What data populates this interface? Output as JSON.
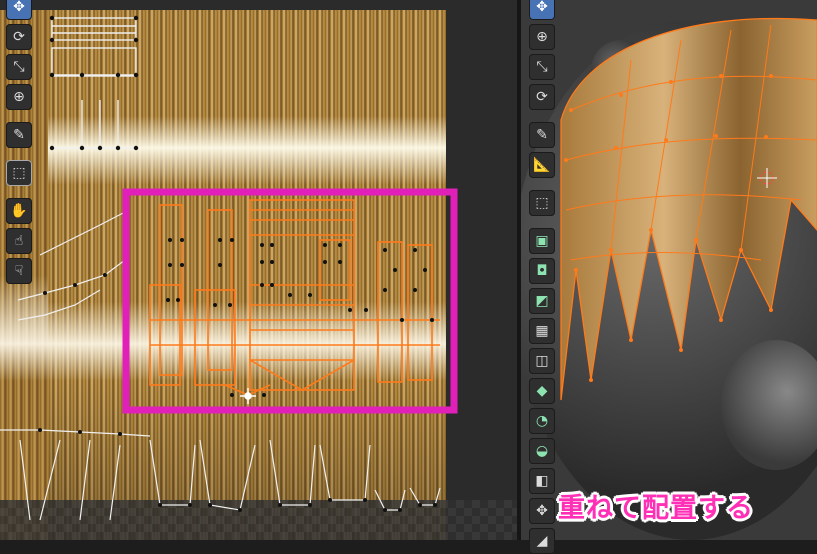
{
  "uv_editor": {
    "tools": [
      {
        "icon": "move-icon",
        "glyph": "✥",
        "active": true
      },
      {
        "icon": "rotate-icon",
        "glyph": "⟳"
      },
      {
        "icon": "scale-icon",
        "glyph": "⤡"
      },
      {
        "icon": "transform-icon",
        "glyph": "⊕"
      },
      {
        "icon": "annotate-icon",
        "glyph": "✎"
      },
      {
        "icon": "cube-icon",
        "glyph": "⬚",
        "active_outline": true
      },
      {
        "icon": "grab-icon",
        "glyph": "✋"
      },
      {
        "icon": "relax-icon",
        "glyph": "☝"
      },
      {
        "icon": "pinch-icon",
        "glyph": "☟"
      }
    ]
  },
  "viewport_3d": {
    "tools": [
      {
        "icon": "move-icon",
        "glyph": "✥",
        "active": true
      },
      {
        "icon": "transform-icon",
        "glyph": "⊕"
      },
      {
        "icon": "scale-icon",
        "glyph": "⤡"
      },
      {
        "icon": "rotate-icon",
        "glyph": "⟳"
      },
      {
        "icon": "annotate-icon",
        "glyph": "✎"
      },
      {
        "icon": "measure-icon",
        "glyph": "📐"
      },
      {
        "icon": "add-cube-icon",
        "glyph": "⬚"
      },
      {
        "icon": "extrude-icon",
        "glyph": "▣",
        "green": true
      },
      {
        "icon": "inset-icon",
        "glyph": "◘",
        "green": true
      },
      {
        "icon": "bevel-icon",
        "glyph": "◩",
        "green": true
      },
      {
        "icon": "loop-cut-icon",
        "glyph": "▦"
      },
      {
        "icon": "knife-icon",
        "glyph": "◫"
      },
      {
        "icon": "poly-build-icon",
        "glyph": "◆",
        "green": true
      },
      {
        "icon": "spin-icon",
        "glyph": "◔",
        "green": true
      },
      {
        "icon": "smooth-icon",
        "glyph": "◒",
        "green": true
      },
      {
        "icon": "edge-slide-icon",
        "glyph": "◧"
      },
      {
        "icon": "shrink-icon",
        "glyph": "✥"
      },
      {
        "icon": "shear-icon",
        "glyph": "◢"
      }
    ]
  },
  "caption": "重ねて配置する",
  "colors": {
    "highlight_box": "#e020b8",
    "uv_selected": "#ff7a1a",
    "uv_unselected": "#e8e8e8",
    "caption": "#ff2fb6"
  }
}
